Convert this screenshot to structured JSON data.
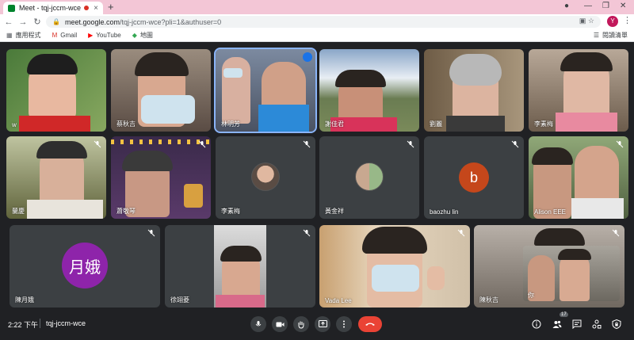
{
  "browser": {
    "tab_title": "Meet - tqj-jccm-wce",
    "tab_close": "×",
    "new_tab": "+",
    "url_host": "meet.google.com",
    "url_path": "/tqj-jccm-wce?pli=1&authuser=0",
    "profile_initial": "Y",
    "bookmarks": [
      {
        "label": "應用程式",
        "icon": "apps-icon"
      },
      {
        "label": "Gmail",
        "icon": "gmail-icon"
      },
      {
        "label": "YouTube",
        "icon": "youtube-icon"
      },
      {
        "label": "地圖",
        "icon": "maps-icon"
      }
    ],
    "reading_list": "閱讀清單"
  },
  "participants": [
    {
      "name": "w",
      "type": "video",
      "muted": false
    },
    {
      "name": "蔡秋吉",
      "type": "video",
      "muted": false
    },
    {
      "name": "林明芳",
      "type": "video",
      "muted": false,
      "speaking": true
    },
    {
      "name": "謝佳君",
      "type": "video",
      "muted": false
    },
    {
      "name": "劉麗",
      "type": "video",
      "muted": false
    },
    {
      "name": "李素梅",
      "type": "video",
      "muted": false
    },
    {
      "name": "蘭慶",
      "type": "video",
      "muted": true
    },
    {
      "name": "蕭敬琴",
      "type": "video",
      "muted": true
    },
    {
      "name": "李素梅",
      "type": "photo",
      "muted": true
    },
    {
      "name": "黃金祥",
      "type": "photo",
      "muted": true
    },
    {
      "name": "baozhu lin",
      "type": "initial",
      "initial": "b",
      "color": "#c5471b",
      "muted": true
    },
    {
      "name": "Alison EEE",
      "type": "video",
      "muted": true
    },
    {
      "name": "陳月娥",
      "type": "initial",
      "initial": "月娥",
      "color": "#8e24aa",
      "muted": true
    },
    {
      "name": "徐翊菱",
      "type": "video",
      "muted": true
    },
    {
      "name": "Vada Lee",
      "type": "video",
      "muted": true
    },
    {
      "name": "陳秋吉",
      "type": "video",
      "muted": true
    }
  ],
  "self_view_label": "你",
  "meeting": {
    "time": "2:22 下午",
    "code": "tqj-jccm-wce",
    "participant_count": "17"
  },
  "colors": {
    "end_call": "#ea4335",
    "speaking": "#1a73e8",
    "background": "#202124"
  }
}
